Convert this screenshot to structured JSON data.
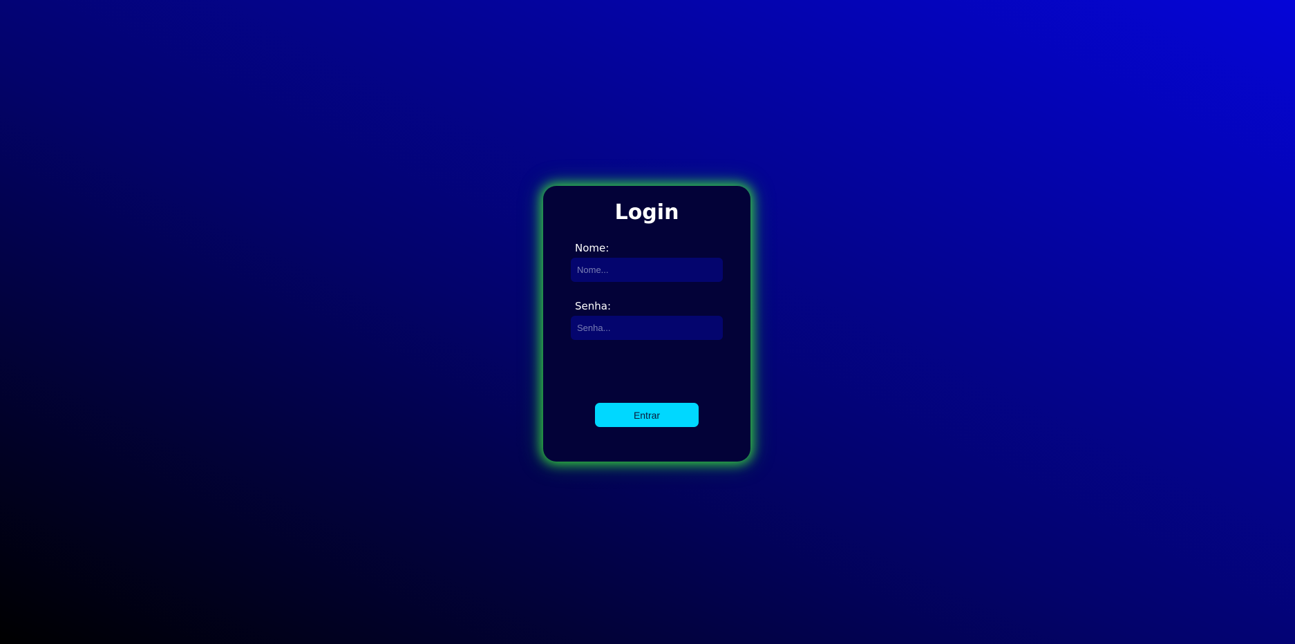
{
  "login": {
    "title": "Login",
    "name_label": "Nome:",
    "name_placeholder": "Nome...",
    "name_value": "",
    "password_label": "Senha:",
    "password_placeholder": "Senha...",
    "password_value": "",
    "submit_label": "Entrar"
  },
  "colors": {
    "card_background": "#030238",
    "card_glow": "#3ce63c",
    "input_background": "#04056e",
    "button_background": "#00d8ff"
  }
}
